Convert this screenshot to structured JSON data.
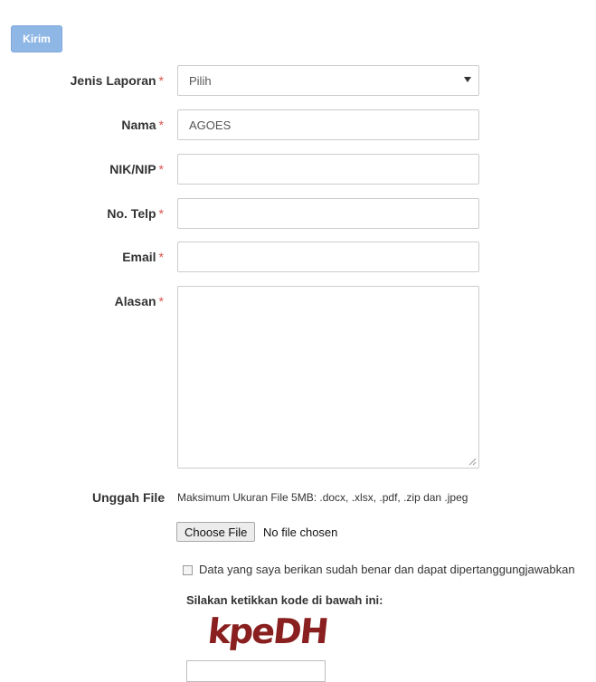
{
  "toolbar": {
    "submit_label": "Kirim"
  },
  "form": {
    "required_mark": "*",
    "jenis_laporan": {
      "label": "Jenis Laporan",
      "value": "Pilih"
    },
    "nama": {
      "label": "Nama",
      "value": "AGOES"
    },
    "nik_nip": {
      "label": "NIK/NIP",
      "value": ""
    },
    "no_telp": {
      "label": "No. Telp",
      "value": ""
    },
    "email": {
      "label": "Email",
      "value": ""
    },
    "alasan": {
      "label": "Alasan",
      "value": ""
    },
    "upload": {
      "label": "Unggah File",
      "hint": "Maksimum Ukuran File 5MB: .docx, .xlsx, .pdf, .zip dan .jpeg",
      "button_label": "Choose File",
      "status": "No file chosen"
    },
    "agreement": {
      "text": "Data yang saya berikan sudah benar dan dapat dipertanggungjawabkan",
      "checked": false
    },
    "captcha": {
      "prompt": "Silakan ketikkan kode di bawah ini:",
      "code": "kpeDH",
      "value": ""
    }
  },
  "colors": {
    "submit_bg": "#8fb7e6",
    "required": "#d9534f",
    "captcha_text": "#8a1f1f"
  },
  "icons": {
    "select_caret": "caret-down-icon",
    "textarea_resize": "resize-grip-icon"
  }
}
